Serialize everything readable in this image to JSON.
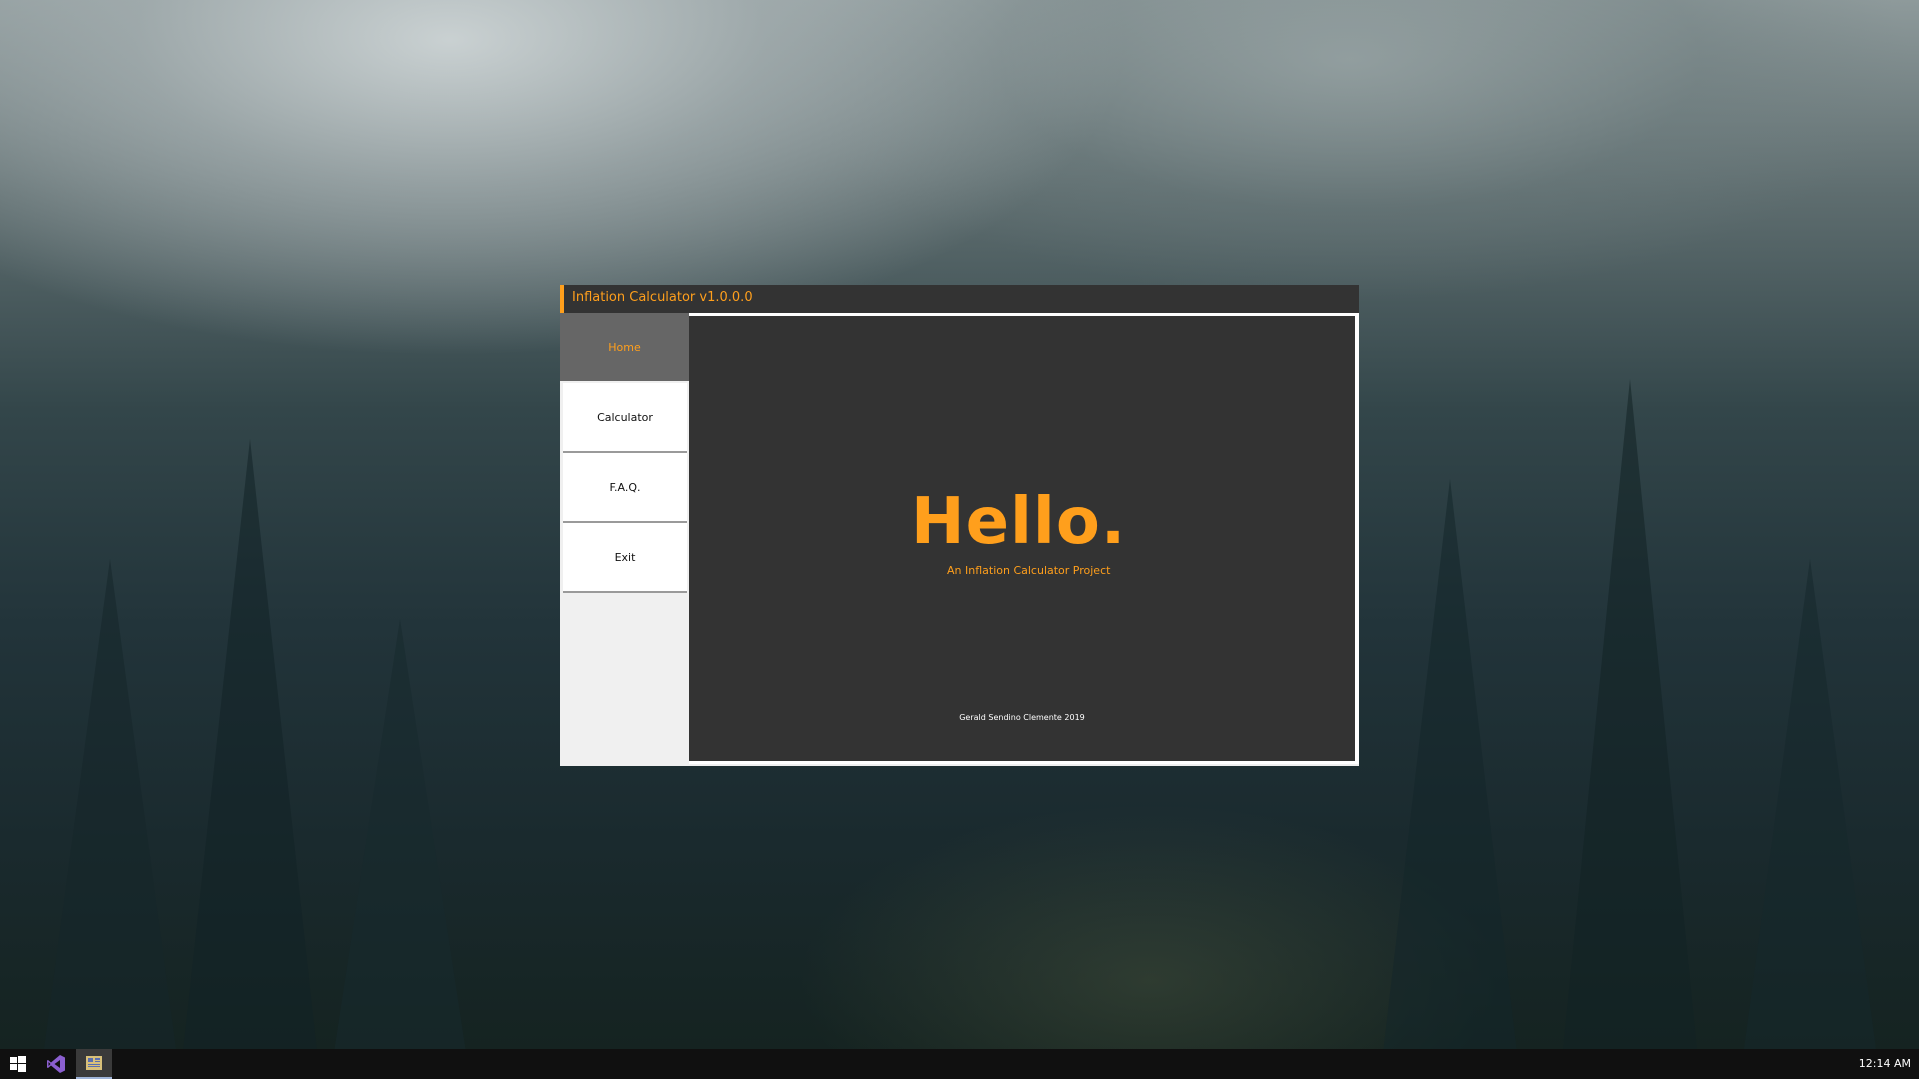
{
  "window": {
    "title": "Inflation Calculator v1.0.0.0"
  },
  "sidebar": {
    "items": [
      {
        "label": "Home",
        "active": true
      },
      {
        "label": "Calculator",
        "active": false
      },
      {
        "label": "F.A.Q.",
        "active": false
      },
      {
        "label": "Exit",
        "active": false
      }
    ]
  },
  "main": {
    "heading": "Hello.",
    "subtitle": "An Inflation Calculator Project",
    "footer": "Gerald Sendino Clemente 2019"
  },
  "taskbar": {
    "apps": [
      {
        "icon": "windows-start-icon"
      },
      {
        "icon": "visual-studio-icon"
      },
      {
        "icon": "inflation-calculator-app-icon"
      }
    ],
    "clock": "12:14 AM"
  },
  "colors": {
    "accent": "#ff9f1c",
    "window_bg": "#333333",
    "active_nav_bg": "#666666",
    "taskbar_bg": "#101010"
  }
}
